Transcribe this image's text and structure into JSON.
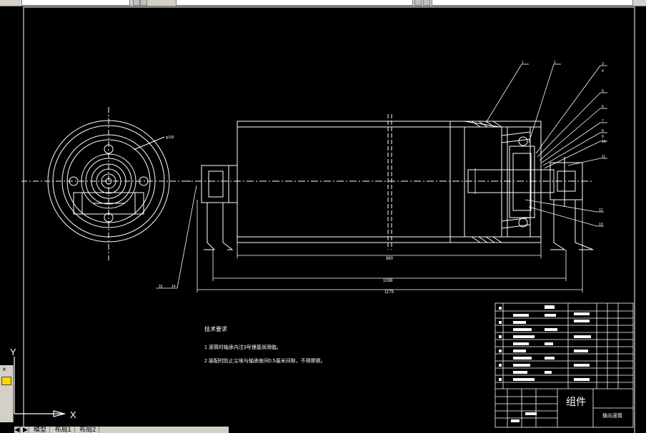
{
  "window": {
    "model_tab": "模型",
    "layout_tabs": [
      "布局1",
      "布局2"
    ],
    "command_panel_close": "×"
  },
  "drawing": {
    "tech_title": "技术要求",
    "tech_lines": [
      "1  滚筒时轴承内注3号锂基润滑脂。",
      "2  装配时防止尘埃与轴承座间0.5毫米间隙，不得摩擦。"
    ],
    "dims": {
      "d_label": "φ100",
      "length_980": "980",
      "length_1038": "1038",
      "length_1175": "1175"
    },
    "balloons": [
      "1",
      "2",
      "3",
      "4",
      "5",
      "6",
      "7",
      "8",
      "9",
      "10",
      "11",
      "12",
      "13",
      "14",
      "15"
    ],
    "title_block": {
      "assembly": "组件",
      "part_name": "换向滚筒"
    },
    "ucs": {
      "x_label": "X",
      "y_label": "Y"
    }
  },
  "colors": {
    "background": "#000000",
    "lines": "#ffffff",
    "ui_chrome": "#d4d0c8"
  }
}
